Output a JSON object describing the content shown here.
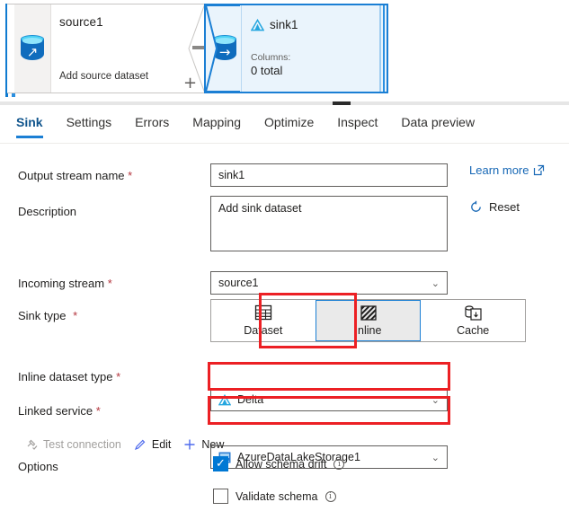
{
  "canvas": {
    "source_node": {
      "title": "source1",
      "subtitle": "Add source dataset",
      "icon": "database-source-icon"
    },
    "add_button_label": "+",
    "sink_node": {
      "title": "sink1",
      "columns_label": "Columns:",
      "columns_value": "0 total",
      "icon": "database-sink-icon",
      "type_icon": "delta-triangle-icon",
      "selected": true
    }
  },
  "tabs": [
    {
      "label": "Sink",
      "active": true
    },
    {
      "label": "Settings",
      "active": false
    },
    {
      "label": "Errors",
      "active": false
    },
    {
      "label": "Mapping",
      "active": false
    },
    {
      "label": "Optimize",
      "active": false
    },
    {
      "label": "Inspect",
      "active": false
    },
    {
      "label": "Data preview",
      "active": false
    }
  ],
  "form": {
    "output_stream_name": {
      "label": "Output stream name",
      "required": "*",
      "value": "sink1"
    },
    "description": {
      "label": "Description",
      "value": "Add sink dataset"
    },
    "incoming_stream": {
      "label": "Incoming stream",
      "required": "*",
      "value": "source1"
    },
    "sink_type": {
      "label": "Sink type",
      "required": "*",
      "options": [
        {
          "label": "Dataset",
          "icon": "table-grid-icon",
          "selected": false
        },
        {
          "label": "Inline",
          "icon": "hatched-square-icon",
          "selected": true
        },
        {
          "label": "Cache",
          "icon": "cache-cylinders-icon",
          "selected": false
        }
      ]
    },
    "inline_dataset_type": {
      "label": "Inline dataset type",
      "required": "*",
      "value": "Delta",
      "icon": "delta-triangle-icon",
      "highlighted": true
    },
    "linked_service": {
      "label": "Linked service",
      "required": "*",
      "value": "AzureDataLakeStorage1",
      "icon": "azure-datalake-icon",
      "highlighted": true
    },
    "actions": {
      "test_connection": {
        "label": "Test connection",
        "icon": "plug-test-icon",
        "disabled": true
      },
      "edit": {
        "label": "Edit",
        "icon": "pencil-icon",
        "disabled": false
      },
      "new": {
        "label": "New",
        "icon": "plus-icon",
        "disabled": false
      }
    },
    "options": {
      "label": "Options",
      "allow_schema_drift": {
        "label": "Allow schema drift",
        "checked": true,
        "info": "ⓘ"
      },
      "validate_schema": {
        "label": "Validate schema",
        "checked": false,
        "info": "ⓘ"
      }
    }
  },
  "side": {
    "learn_more": {
      "label": "Learn more",
      "icon": "external-link-icon"
    },
    "reset": {
      "label": "Reset",
      "icon": "refresh-icon"
    }
  },
  "colors": {
    "accent": "#0078d4",
    "selected_border": "#1b7fd4",
    "annotation_red": "#ec2024",
    "required_red": "#b4363e",
    "link_blue": "#1667b5"
  }
}
